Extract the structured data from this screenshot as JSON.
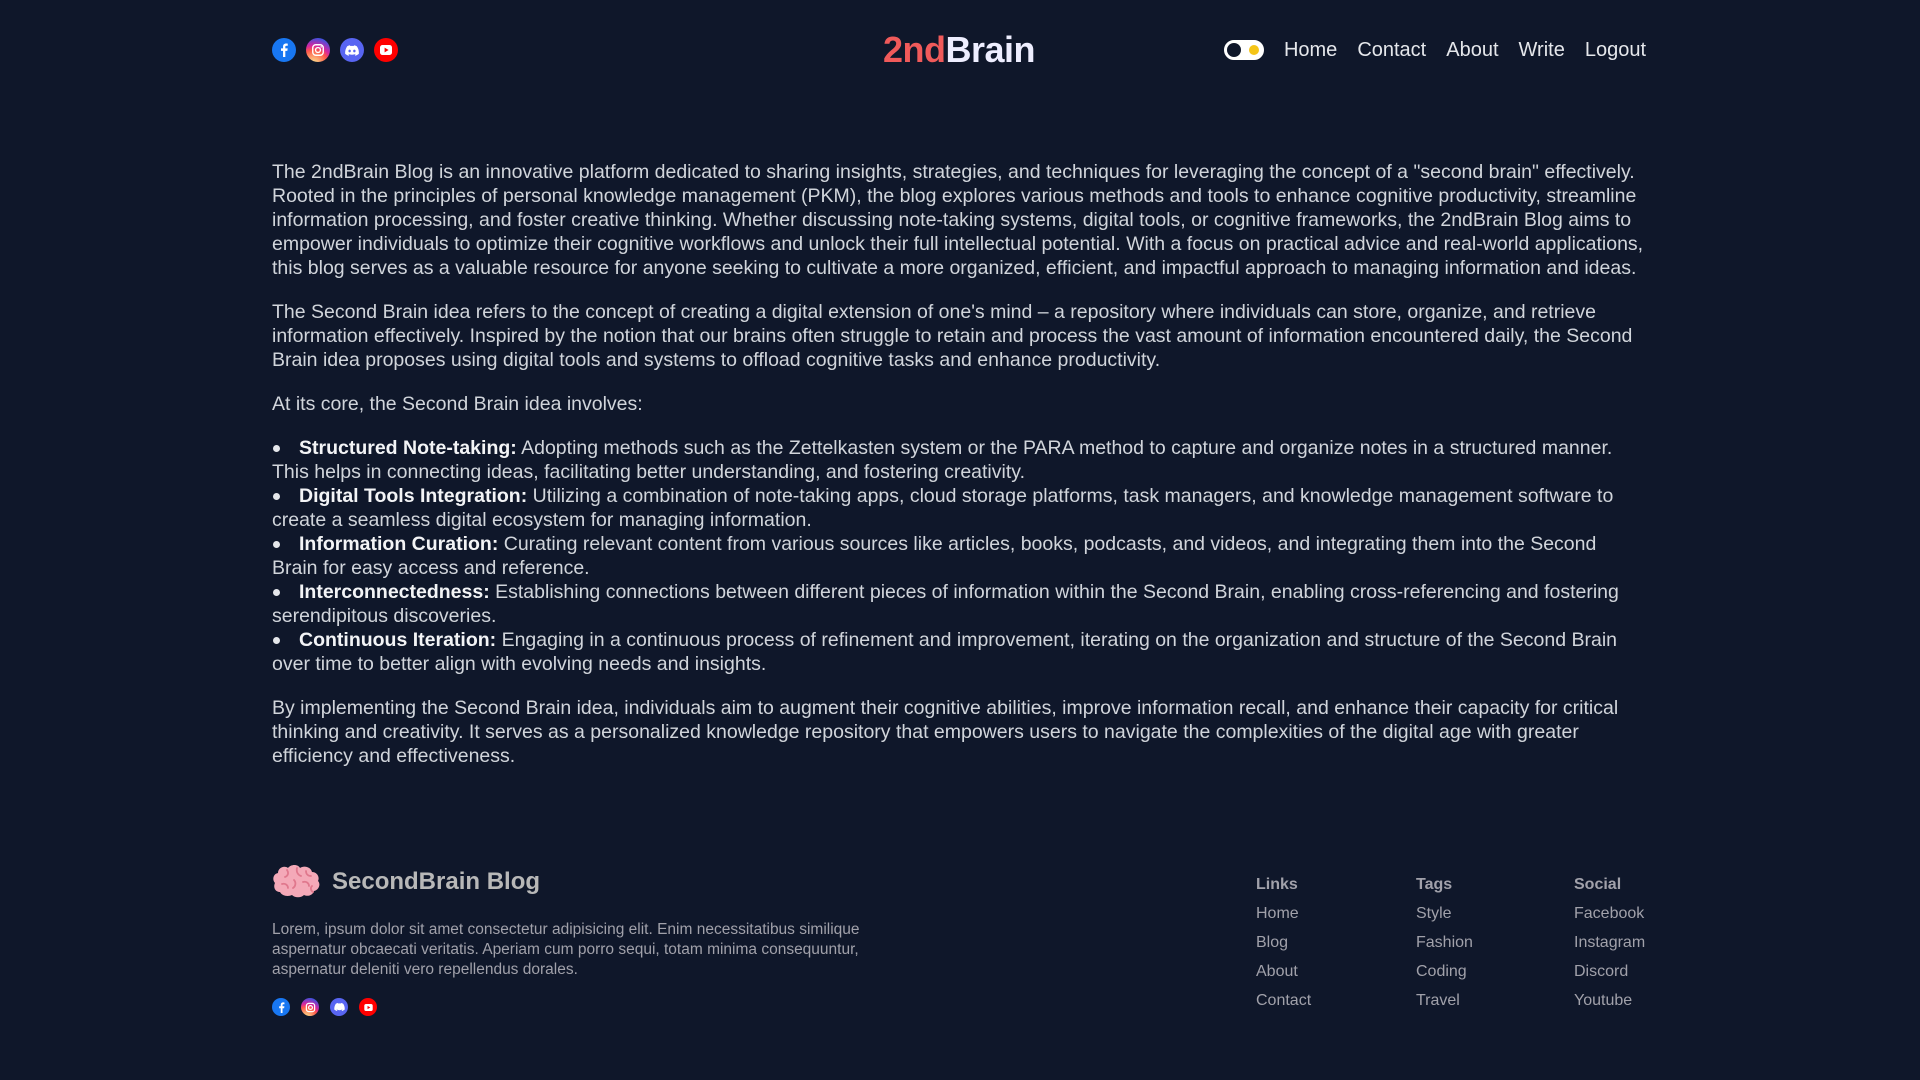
{
  "navbar": {
    "social_icons": [
      "facebook-icon",
      "instagram-icon",
      "discord-icon",
      "youtube-icon"
    ],
    "logo_accent": "2nd",
    "logo_main": "Brain",
    "links": [
      "Home",
      "Contact",
      "About",
      "Write",
      "Logout"
    ]
  },
  "content": {
    "p1": "The 2ndBrain Blog is an innovative platform dedicated to sharing insights, strategies, and techniques for leveraging the concept of a \"second brain\" effectively. Rooted in the principles of personal knowledge management (PKM), the blog explores various methods and tools to enhance cognitive productivity, streamline information processing, and foster creative thinking. Whether discussing note-taking systems, digital tools, or cognitive frameworks, the 2ndBrain Blog aims to empower individuals to optimize their cognitive workflows and unlock their full intellectual potential. With a focus on practical advice and real-world applications, this blog serves as a valuable resource for anyone seeking to cultivate a more organized, efficient, and impactful approach to managing information and ideas.",
    "p2": "The Second Brain idea refers to the concept of creating a digital extension of one's mind – a repository where individuals can store, organize, and retrieve information effectively. Inspired by the notion that our brains often struggle to retain and process the vast amount of information encountered daily, the Second Brain idea proposes using digital tools and systems to offload cognitive tasks and enhance productivity.",
    "intro": "At its core, the Second Brain idea involves:",
    "bullets": [
      {
        "title": "Structured Note-taking:",
        "text": " Adopting methods such as the Zettelkasten system or the PARA method to capture and organize notes in a structured manner. This helps in connecting ideas, facilitating better understanding, and fostering creativity."
      },
      {
        "title": "Digital Tools Integration:",
        "text": " Utilizing a combination of note-taking apps, cloud storage platforms, task managers, and knowledge management software to create a seamless digital ecosystem for managing information."
      },
      {
        "title": "Information Curation:",
        "text": " Curating relevant content from various sources like articles, books, podcasts, and videos, and integrating them into the Second Brain for easy access and reference."
      },
      {
        "title": "Interconnectedness:",
        "text": " Establishing connections between different pieces of information within the Second Brain, enabling cross-referencing and fostering serendipitous discoveries."
      },
      {
        "title": "Continuous Iteration:",
        "text": " Engaging in a continuous process of refinement and improvement, iterating on the organization and structure of the Second Brain over time to better align with evolving needs and insights."
      }
    ],
    "p3": "By implementing the Second Brain idea, individuals aim to augment their cognitive abilities, improve information recall, and enhance their capacity for critical thinking and creativity. It serves as a personalized knowledge repository that empowers users to navigate the complexities of the digital age with greater efficiency and effectiveness."
  },
  "footer": {
    "brand": "SecondBrain Blog",
    "description": "Lorem, ipsum dolor sit amet consectetur adipisicing elit. Enim necessitatibus similique aspernatur obcaecati veritatis. Aperiam cum porro sequi, totam minima consequuntur, aspernatur deleniti vero repellendus dorales.",
    "columns": [
      {
        "title": "Links",
        "items": [
          "Home",
          "Blog",
          "About",
          "Contact"
        ]
      },
      {
        "title": "Tags",
        "items": [
          "Style",
          "Fashion",
          "Coding",
          "Travel"
        ]
      },
      {
        "title": "Social",
        "items": [
          "Facebook",
          "Instagram",
          "Discord",
          "Youtube"
        ]
      }
    ]
  },
  "colors": {
    "background": "#0f172a",
    "logo_accent": "#f05a5a"
  }
}
